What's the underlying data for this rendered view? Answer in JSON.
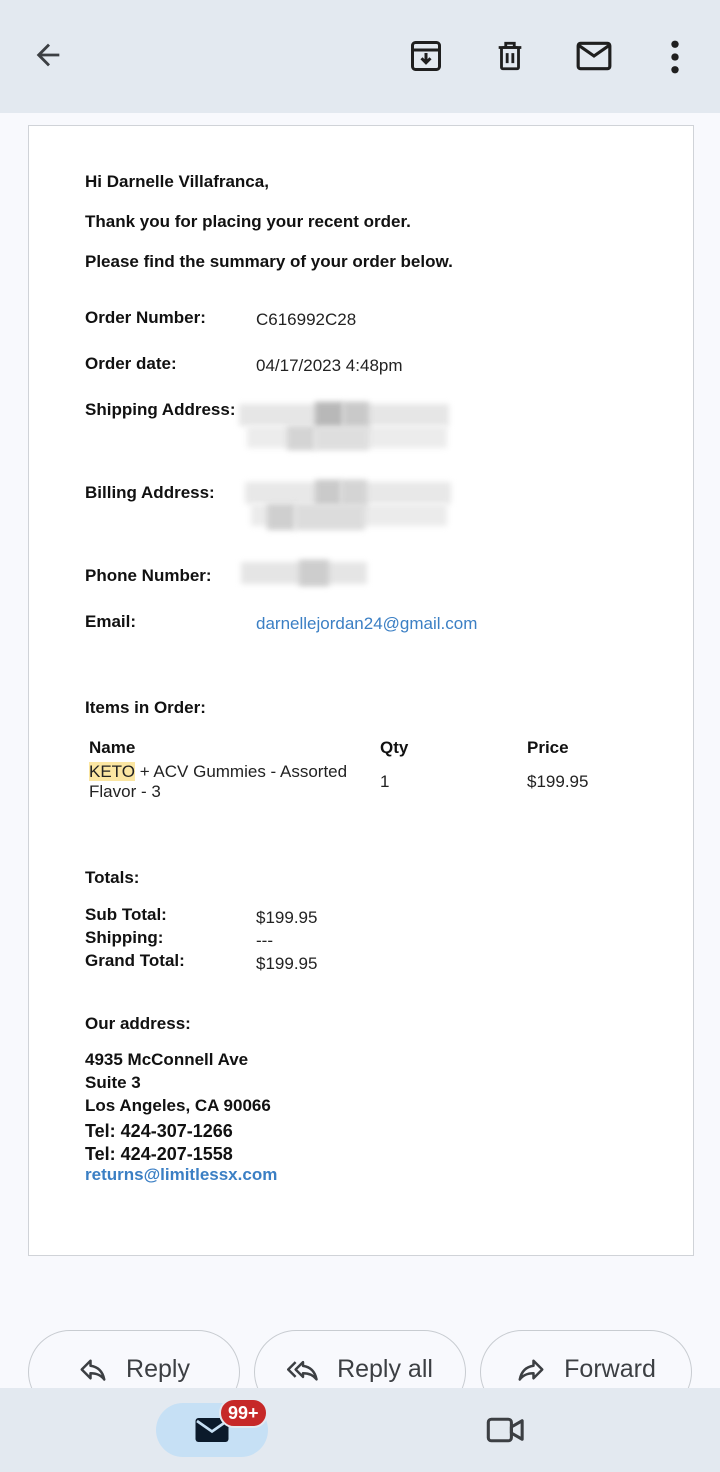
{
  "email": {
    "greeting": "Hi Darnelle Villafranca,",
    "thank_you": "Thank you for placing your recent order.",
    "summary_intro": "Please find the summary of your order below.",
    "fields": {
      "order_number_label": "Order Number:",
      "order_number_value": "C616992C28",
      "order_date_label": "Order date:",
      "order_date_value": "04/17/2023 4:48pm",
      "shipping_label": "Shipping Address:",
      "billing_label": "Billing Address:",
      "phone_label": "Phone Number:",
      "email_label": "Email:",
      "email_value": "darnellejordan24@gmail.com"
    },
    "items_heading": "Items in Order:",
    "items_table": {
      "headers": [
        "Name",
        "Qty",
        "Price"
      ],
      "rows": [
        {
          "name_highlight": "KETO",
          "name_rest": " + ACV Gummies - Assorted",
          "name_line2": "Flavor - 3",
          "qty": "1",
          "price": "$199.95"
        }
      ]
    },
    "totals": {
      "heading": "Totals:",
      "sub_total_label": "Sub Total:",
      "sub_total_value": "$199.95",
      "shipping_label": "Shipping:",
      "shipping_value": "---",
      "grand_total_label": "Grand Total:",
      "grand_total_value": "$199.95"
    },
    "our_address": {
      "heading": "Our address:",
      "line1": "4935 McConnell Ave",
      "line2": "Suite 3",
      "line3": "Los Angeles, CA 90066",
      "tel1": "Tel: 424-307-1266",
      "tel2": "Tel: 424-207-1558",
      "email": "returns@limitlessx.com"
    }
  },
  "actions": {
    "reply": "Reply",
    "reply_all": "Reply all",
    "forward": "Forward"
  },
  "bottom_nav": {
    "mail_badge": "99+"
  },
  "icons": {
    "back": "arrow-left-icon",
    "archive": "archive-icon",
    "delete": "trash-icon",
    "mark_unread": "mail-icon",
    "more": "more-vert-icon",
    "reply": "reply-icon",
    "reply_all": "reply-all-icon",
    "forward": "forward-icon",
    "mail": "mail-icon",
    "meet": "video-camera-icon"
  },
  "colors": {
    "link": "#3b7fc4",
    "highlight": "#fbe6a2",
    "badge": "#c62828",
    "topbar": "#e3e9f0",
    "mail_pill": "#c6e0f5"
  }
}
